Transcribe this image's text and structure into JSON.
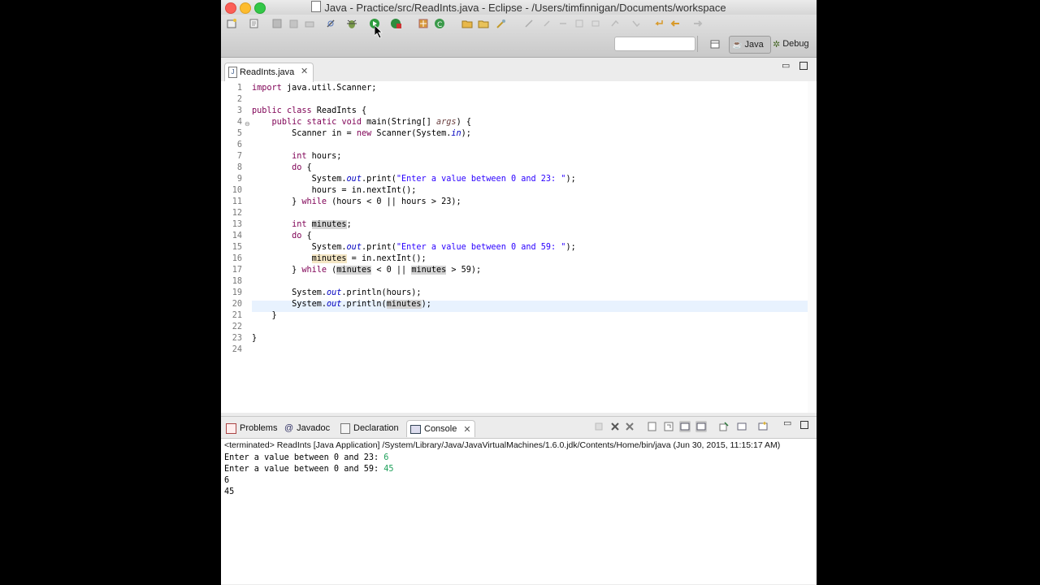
{
  "window": {
    "title": "Java - Practice/src/ReadInts.java - Eclipse - /Users/timfinnigan/Documents/workspace"
  },
  "perspectives": {
    "java": "Java",
    "debug": "Debug"
  },
  "editor": {
    "tab_label": "ReadInts.java",
    "line_numbers": [
      "1",
      "2",
      "3",
      "4",
      "5",
      "6",
      "7",
      "8",
      "9",
      "10",
      "11",
      "12",
      "13",
      "14",
      "15",
      "16",
      "17",
      "18",
      "19",
      "20",
      "21",
      "22",
      "23",
      "24"
    ],
    "current_line": 20
  },
  "console": {
    "tabs": {
      "problems": "Problems",
      "javadoc": "Javadoc",
      "declaration": "Declaration",
      "console": "Console"
    },
    "header": "<terminated> ReadInts [Java Application] /System/Library/Java/JavaVirtualMachines/1.6.0.jdk/Contents/Home/bin/java (Jun 30, 2015, 11:15:17 AM)",
    "lines": [
      {
        "prompt": "Enter a value between 0 and 23: ",
        "input": "6"
      },
      {
        "prompt": "Enter a value between 0 and 59: ",
        "input": "45"
      },
      {
        "prompt": "6",
        "input": ""
      },
      {
        "prompt": "45",
        "input": ""
      }
    ]
  },
  "colors": {
    "keyword": "#7f0055",
    "string": "#2a00ff",
    "static_field": "#0000c0",
    "console_input": "#1ea05a",
    "current_line": "#e8f2fe"
  }
}
